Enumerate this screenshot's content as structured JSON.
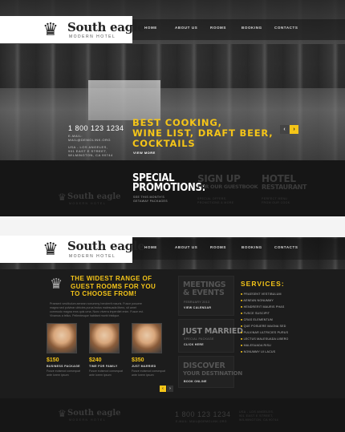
{
  "brand": {
    "name": "South eagle",
    "tagline": "MODERN HOTEL"
  },
  "nav": [
    "HOME",
    "ABOUT US",
    "ROOMS",
    "BOOKING",
    "CONTACTS"
  ],
  "contact": {
    "phone": "1 800 123 1234",
    "email_label": "E-MAIL:",
    "email": "MAIL@DEMOLINK.ORG",
    "address_1": "USA - LOS ANGELES,",
    "address_2": "901 EAST E STREET,",
    "address_3": "WILMINGTON, CA 90744"
  },
  "hero": {
    "headline_1": "BEST COOKING,",
    "headline_2": "WINE LIST, DRAFT BEER,",
    "headline_3": "COCKTAILS",
    "view_more": "VIEW MORE"
  },
  "promos": [
    {
      "title_1": "SPECIAL",
      "title_2": "PROMOTIONS:",
      "sub_1": "SEE THIS MONTH'S",
      "sub_2": "GETAWAY PACKAGES"
    },
    {
      "title_1": "SIGN UP",
      "title_2": "FOR OUR GUESTBOOK",
      "sub_1": "SPECIAL OFFERS,",
      "sub_2": "PROMOTIONS & MORE"
    },
    {
      "title_1": "HOTEL",
      "title_2": "RESTAURANT",
      "sub_1": "PERFECT MENU",
      "sub_2": "FROM OUR COOK"
    }
  ],
  "intro": {
    "title_1": "THE WIDEST RANGE OF",
    "title_2": "GUEST ROOMS FOR YOU",
    "title_3": "TO CHOOSE FROM!",
    "body_1": "Praesent vestibulum aenean nonummy hendrerit mauris. Fusce posuere",
    "body_2": "magna sed pulvinar ultricies purus lectus malesuada libero, sit amet",
    "body_3": "commodo magna eros quis urna. Nunc viverra imperdiet enim. Fusce est.",
    "body_4": "Vivamus a tellus. Pellentesque habitant morbi tristique."
  },
  "packages": [
    {
      "price": "$150",
      "label": "BUSINESS PACKAGE",
      "desc_1": "Fusce euismod consequat",
      "desc_2": "ante lorem ipsum"
    },
    {
      "price": "$240",
      "label": "TIME FOR FAMILY",
      "desc_1": "Fusce euismod consequat",
      "desc_2": "ante lorem ipsum"
    },
    {
      "price": "$350",
      "label": "JUST MARRIED",
      "desc_1": "Fusce euismod consequat",
      "desc_2": "ante lorem ipsum"
    }
  ],
  "panels": {
    "meetings_1": "MEETINGS",
    "meetings_2": "& EVENTS",
    "meetings_date": "FEBRUARY 2013",
    "meetings_link": "VIEW CALENDAR",
    "married_title": "JUST MARRIED",
    "married_sub": "SPECIAL PACKAGE",
    "married_link": "CLICK HERE",
    "discover_1": "DISCOVER",
    "discover_2": "YOUR DESTINATION",
    "discover_link": "BOOK ONLINE"
  },
  "services": {
    "title": "SERVICES:",
    "items": [
      "PRAESENT VESTIBULUM",
      "AENEAN NONUMMY",
      "HENDRERIT MAURIS PHAS",
      "FUSCE SUSCIPIT",
      "CRAS ELEMENTUM",
      "QUE POSUERE MAGNA SED",
      "PULVINAR ULTRICIES PURUS",
      "LECTUS MALESUADA LIBERO",
      "MALESUADA RISU",
      "NONUMMY UI LACUS"
    ]
  },
  "footer": {
    "phone": "1 800 123 1234",
    "email": "E-MAIL: MAIL@DEMOLINK.ORG",
    "address_1": "USA - LOS ANGELES,",
    "address_2": "901 EAST E STREET,",
    "address_3": "WILMINGTON, CA 90744"
  }
}
